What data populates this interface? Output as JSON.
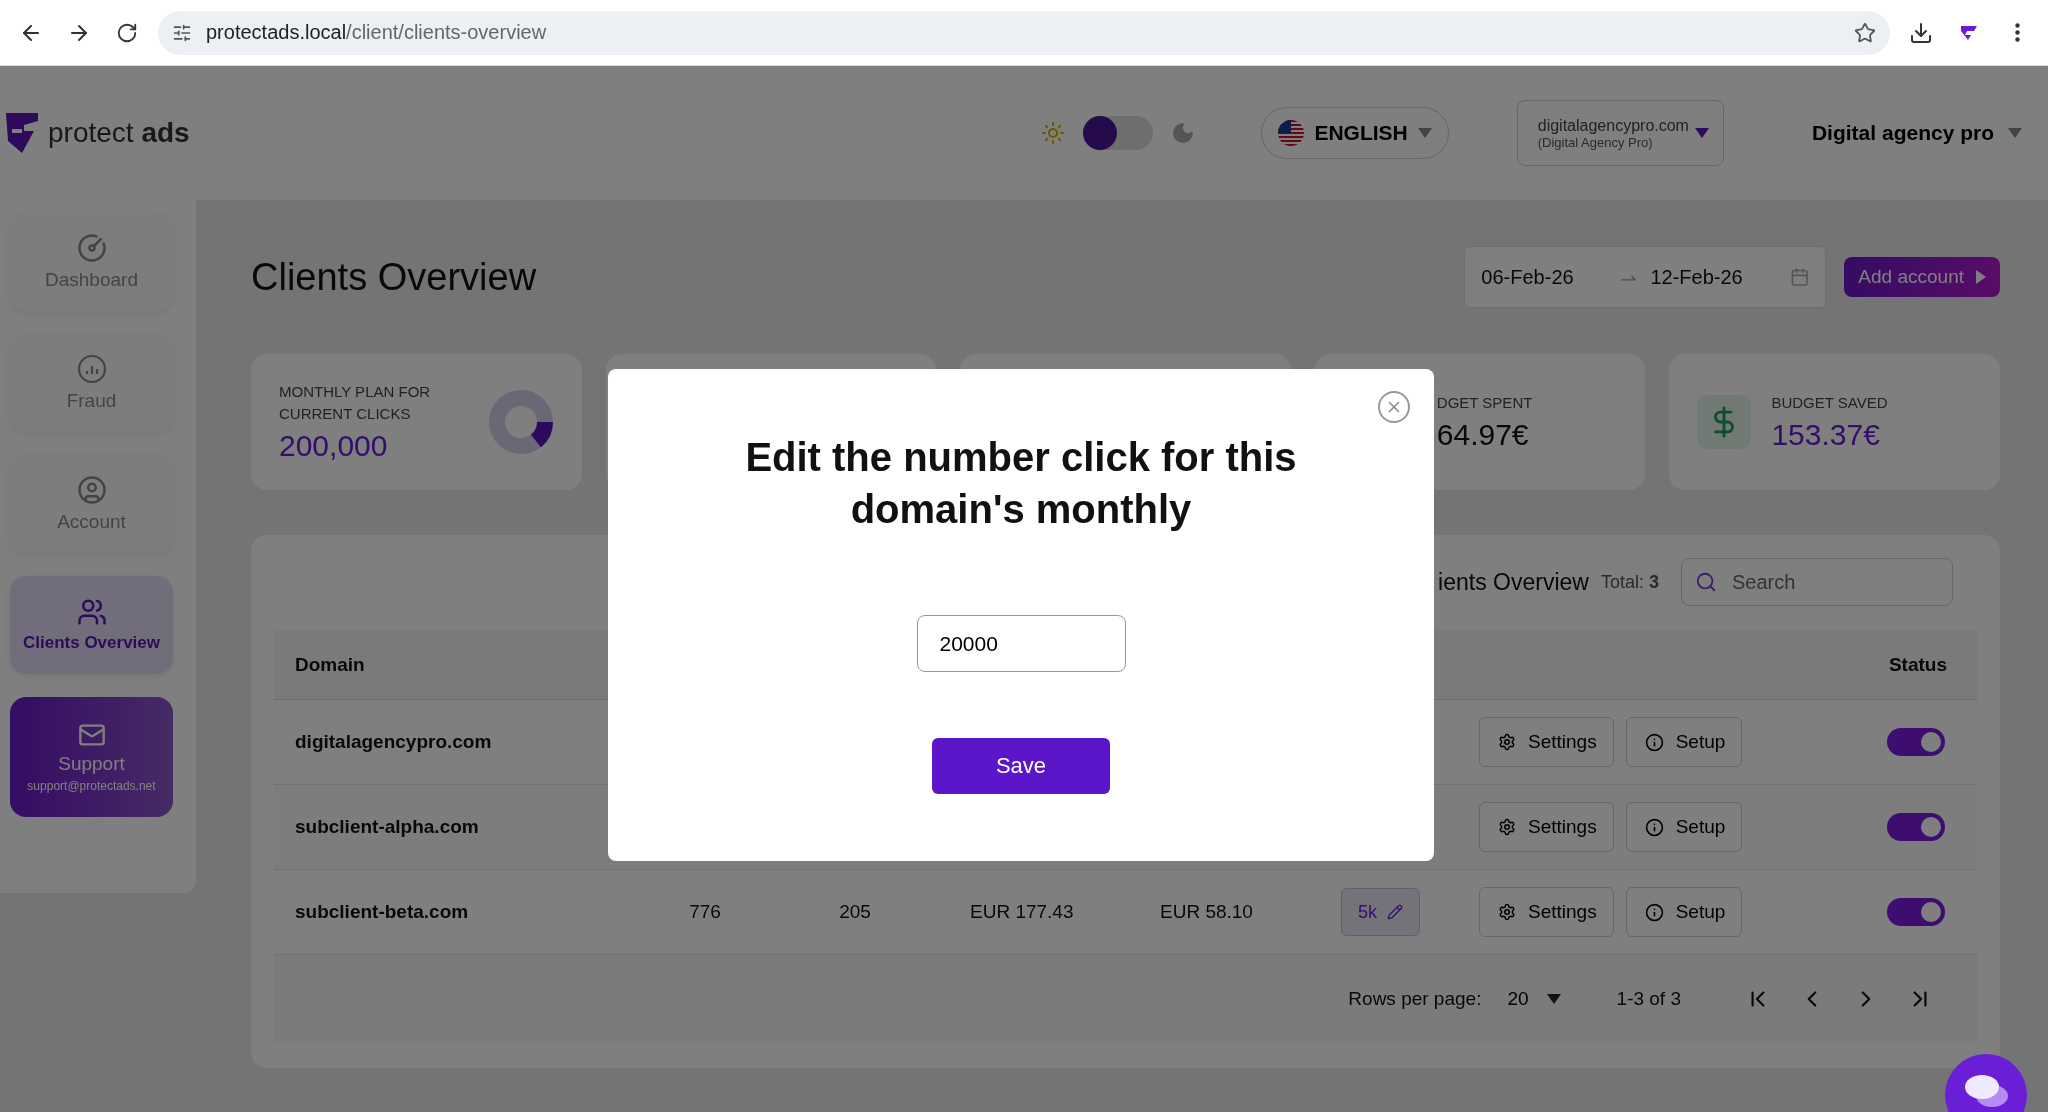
{
  "browser": {
    "url_host": "protectads.local",
    "url_path": "/client/clients-overview"
  },
  "header": {
    "logo": "protect **ads**",
    "dark_mode": false,
    "language": "ENGLISH",
    "account": {
      "domain": "digitalagencypro.com",
      "name": "(Digital Agency Pro)"
    },
    "user": "Digital agency pro"
  },
  "sidebar": {
    "items": [
      {
        "label": "Dashboard",
        "selected": false
      },
      {
        "label": "Fraud",
        "selected": false
      },
      {
        "label": "Account",
        "selected": false
      },
      {
        "label": "Clients Overview",
        "selected": true
      }
    ],
    "support": {
      "label": "Support",
      "email": "support@protectads.net"
    }
  },
  "page": {
    "title": "Clients Overview",
    "date_range": {
      "start": "06-Feb-26",
      "end": "12-Feb-26"
    },
    "add_account": "Add account"
  },
  "stats": [
    {
      "kind": "donut",
      "label": "MONTHLY PLAN FOR CURRENT CLICKS",
      "value": "200,000"
    },
    {
      "kind": "hidden"
    },
    {
      "kind": "hidden"
    },
    {
      "kind": "partial",
      "label": "DGET SPENT",
      "value": "64.97€"
    },
    {
      "kind": "money",
      "label": "BUDGET SAVED",
      "value": "153.37€"
    }
  ],
  "table": {
    "title": "ients Overview",
    "total_label": "Total:",
    "total": "3",
    "search": {
      "placeholder": "Search"
    },
    "columns": [
      {
        "kind": "domain",
        "label": "Domain"
      },
      {
        "kind": "status",
        "label": "Status"
      }
    ],
    "rows": [
      {
        "domain": "digitalagencypro.com",
        "settings": "Settings",
        "setup": "Setup",
        "on": true
      },
      {
        "domain": "subclient-alpha.com",
        "settings": "Settings",
        "setup": "Setup",
        "on": true
      },
      {
        "domain": "subclient-beta.com",
        "cells": [
          "776",
          "205",
          "EUR 177.43",
          "EUR 58.10"
        ],
        "limit": "5k",
        "settings": "Settings",
        "setup": "Setup",
        "on": true
      }
    ],
    "pagination": {
      "rows_per_page_label": "Rows per page:",
      "rows_per_page": "20",
      "range": "1-3 of 3"
    }
  },
  "modal": {
    "title": "Edit the number click for this domain's monthly",
    "value": "20000",
    "save": "Save"
  }
}
